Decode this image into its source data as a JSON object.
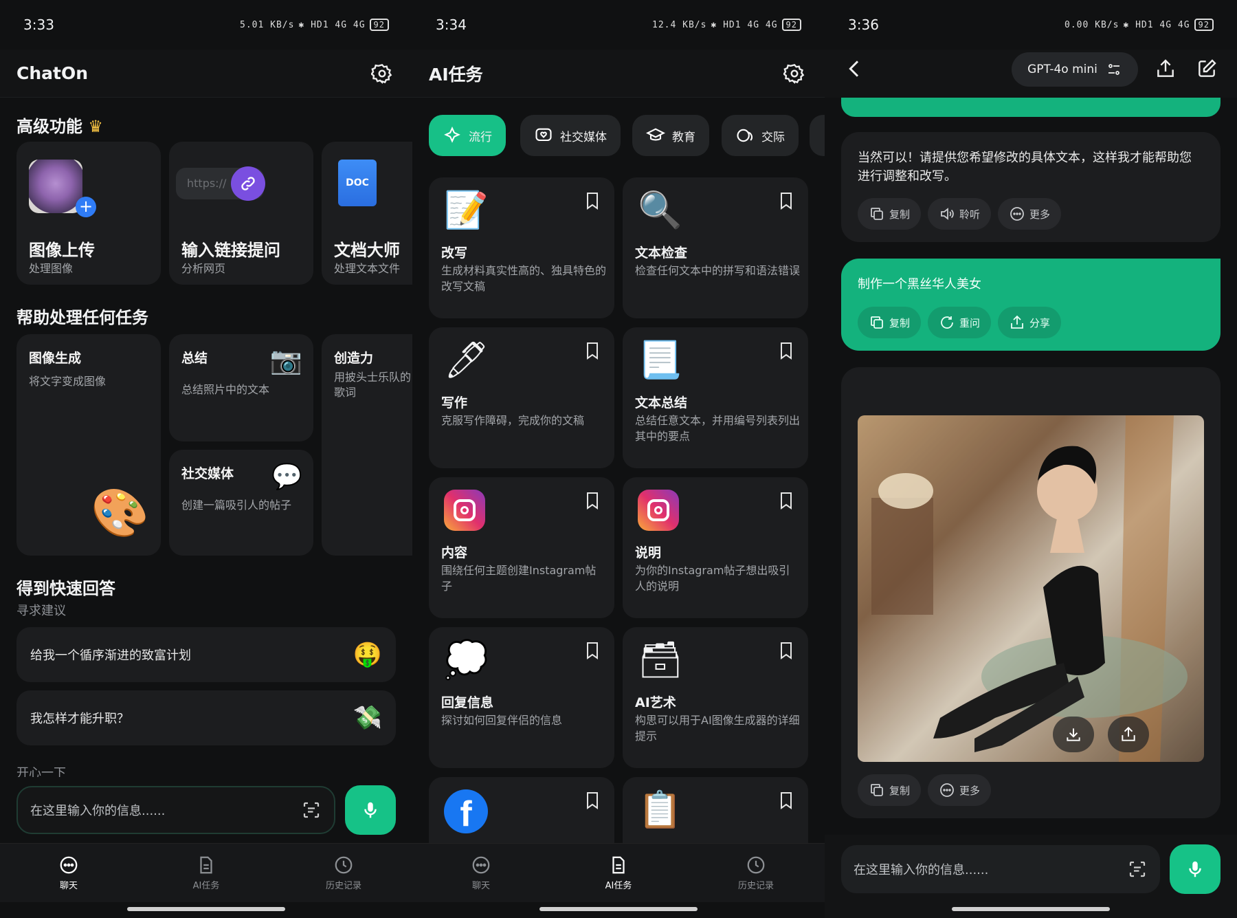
{
  "screen1": {
    "status": {
      "time": "3:33",
      "net": "5.01 KB/s",
      "icons": "✱ HD1 4G 4G",
      "battery": "92"
    },
    "header": {
      "title": "ChatOn"
    },
    "premium": {
      "title": "高级功能",
      "cards": [
        {
          "title": "图像上传",
          "sub": "处理图像"
        },
        {
          "title": "输入链接提问",
          "sub": "分析网页",
          "url_hint": "https://"
        },
        {
          "title": "文档大师",
          "sub": "处理文本文件",
          "doc_badge": "DOC"
        }
      ]
    },
    "tasks": {
      "title": "帮助处理任何任务",
      "cards": [
        {
          "title": "图像生成",
          "sub": "将文字变成图像"
        },
        {
          "title": "总结",
          "sub": "总结照片中的文本"
        },
        {
          "title": "社交媒体",
          "sub": "创建一篇吸引人的帖子"
        },
        {
          "title": "创造力",
          "sub": "用披头士乐队的歌词"
        }
      ]
    },
    "quick": {
      "title": "得到快速回答",
      "sub": "寻求建议",
      "items": [
        "给我一个循序渐进的致富计划",
        "我怎样才能升职？"
      ],
      "next_section": "开心一下"
    },
    "input": {
      "placeholder": "在这里输入你的信息......"
    },
    "tabs": [
      "聊天",
      "AI任务",
      "历史记录"
    ]
  },
  "screen2": {
    "status": {
      "time": "3:34",
      "net": "12.4 KB/s",
      "icons": "✱ HD1 4G 4G",
      "battery": "92"
    },
    "header": {
      "title": "AI任务"
    },
    "chips": [
      "流行",
      "社交媒体",
      "教育",
      "交际"
    ],
    "cards": [
      {
        "icon": "📝",
        "title": "改写",
        "desc": "生成材料真实性高的、独具特色的改写文稿"
      },
      {
        "icon": "🔍",
        "title": "文本检查",
        "desc": "检查任何文本中的拼写和语法错误"
      },
      {
        "icon": "🖊",
        "title": "写作",
        "desc": "克服写作障碍，完成你的文稿"
      },
      {
        "icon": "📃",
        "title": "文本总结",
        "desc": "总结任意文本，并用编号列表列出其中的要点"
      },
      {
        "icon": "",
        "title": "内容",
        "desc": "围绕任何主题创建Instagram帖子"
      },
      {
        "icon": "",
        "title": "说明",
        "desc": "为你的Instagram帖子想出吸引人的说明"
      },
      {
        "icon": "💭",
        "title": "回复信息",
        "desc": "探讨如何回复伴侣的信息"
      },
      {
        "icon": "🗃",
        "title": "AI艺术",
        "desc": "构思可以用于AI图像生成器的详细提示"
      },
      {
        "icon": "",
        "title": "",
        "desc": ""
      },
      {
        "icon": "📋",
        "title": "",
        "desc": ""
      }
    ],
    "facebook_glyph": "f",
    "tabs": [
      "聊天",
      "AI任务",
      "历史记录"
    ]
  },
  "screen3": {
    "status": {
      "time": "3:36",
      "net": "0.00 KB/s",
      "icons": "✱ HD1 4G 4G",
      "battery": "92"
    },
    "model": "GPT-4o mini",
    "ai_message": "当然可以！请提供您希望修改的具体文本，这样我才能帮助您进行调整和改写。",
    "ai_actions": [
      "复制",
      "聆听",
      "更多"
    ],
    "user_message": "制作一个黑丝华人美女",
    "user_actions": [
      "复制",
      "重问",
      "分享"
    ],
    "image_actions": [
      "复制",
      "更多"
    ],
    "input": {
      "placeholder": "在这里输入你的信息......"
    }
  },
  "colors": {
    "accent": "#16c287",
    "bg": "#101112",
    "card": "#1c1d1f"
  }
}
